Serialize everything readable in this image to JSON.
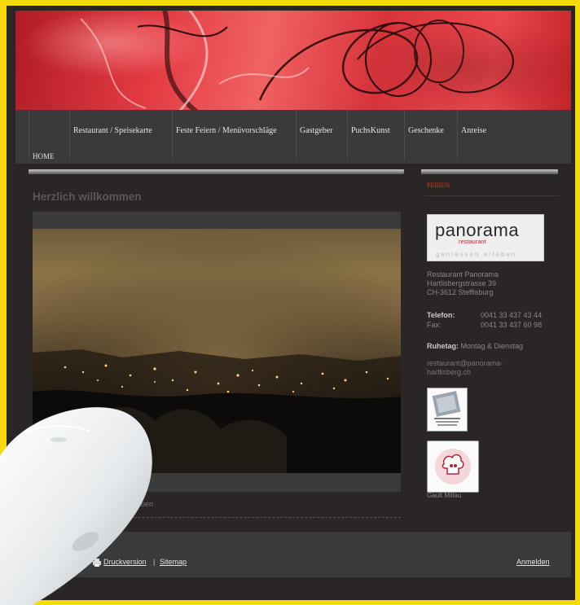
{
  "nav": {
    "items": [
      {
        "label": "HOME"
      },
      {
        "label": "Restaurant / Speisekarte"
      },
      {
        "label": "Feste Feiern / Menüvorschläge"
      },
      {
        "label": "Gastgeber"
      },
      {
        "label": "PuchsKunst"
      },
      {
        "label": "Geschenke"
      },
      {
        "label": "Anreise"
      }
    ]
  },
  "main": {
    "title": "Herzlich willkommen",
    "caption": "eben"
  },
  "sidebar": {
    "heading": "FERIEN",
    "logo": {
      "word": "panorama",
      "sub": "restaurant",
      "tagline": "geniessen erleben"
    },
    "address": [
      "Restaurant Panorama",
      "Hartlisbergstrasse 39",
      "CH-3612 Steffisburg"
    ],
    "phone_label": "Telefon:",
    "phone": "0041 33 437 43 44",
    "fax_label": "Fax:",
    "fax": "0041 33 437 60 98",
    "closed_label": "Ruhetag:",
    "closed": "Montag & Dienstag",
    "email_line1": "restaurant@panorama-",
    "email_line2": "hartlisberg.ch",
    "gault": "Gault Millau"
  },
  "footer": {
    "print": "Druckversion",
    "sep": "|",
    "sitemap": "Sitemap",
    "login": "Anmelden"
  },
  "colors": {
    "accent": "#e0301e",
    "page_bg": "#2b2626",
    "frame": "#f5d90a"
  }
}
